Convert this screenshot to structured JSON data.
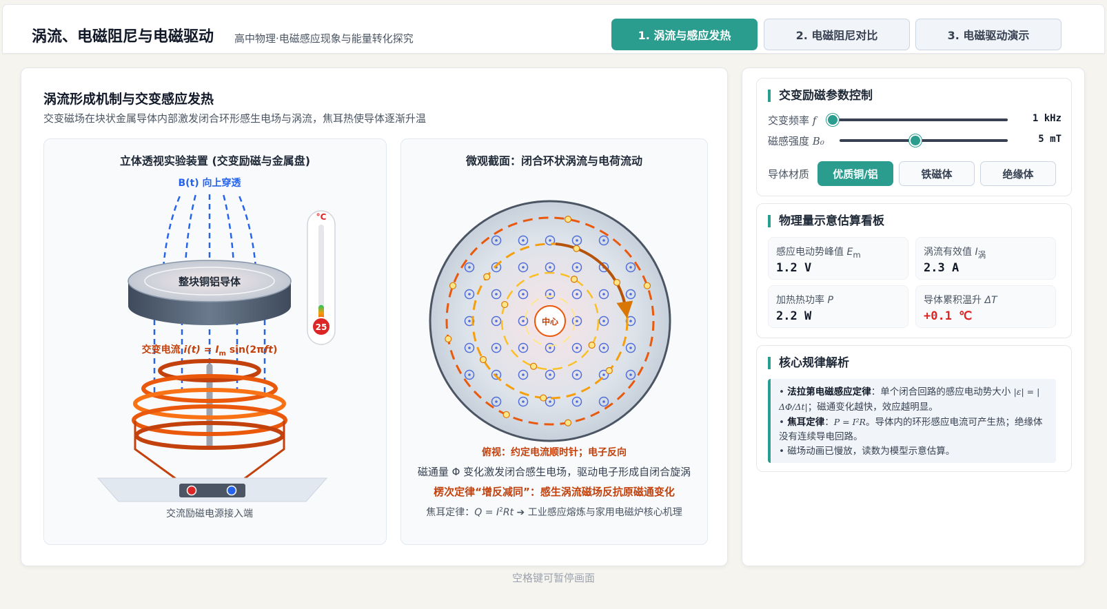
{
  "header": {
    "title": "涡流、电磁阻尼与电磁驱动",
    "subtitle": "高中物理·电磁感应现象与能量转化探究",
    "tabs": [
      {
        "label": "1. 涡流与感应发热",
        "active": true
      },
      {
        "label": "2. 电磁阻尼对比",
        "active": false
      },
      {
        "label": "3. 电磁驱动演示",
        "active": false
      }
    ]
  },
  "main": {
    "title": "涡流形成机制与交变感应发热",
    "description": "交变磁场在块状金属导体内部激发闭合环形感生电场与涡流，焦耳热使导体逐渐升温",
    "left_panel": {
      "title": "立体透视实验装置 (交变励磁与金属盘)",
      "field_label": "B(t) 向上穿透",
      "disk_label": "整块铜铝导体",
      "thermo_unit": "°C",
      "thermo_value": "25",
      "thermo_level": 0.2,
      "current_label_a": "交变电流 ",
      "current_label_i": "i(t)",
      "current_label_b": " = ",
      "current_label_c": "I",
      "current_label_sub": "m",
      "current_label_d": " sin(2π",
      "current_label_e": "ft",
      "current_label_f": ")",
      "source_label": "交流励磁电源接入端"
    },
    "right_panel": {
      "title": "微观截面：闭合环状涡流与电荷流动",
      "center_label": "中心",
      "view_caption": "俯视：约定电流顺时针；电子反向",
      "flux_caption": "磁通量 Φ 变化激发闭合感生电场，驱动电子形成自闭合旋涡",
      "lenz_caption": "楞次定律“增反减同”：感生涡流磁场反抗原磁通变化",
      "joule_a": "焦耳定律：",
      "joule_formula_a": "Q",
      "joule_formula_b": " = ",
      "joule_formula_c": "I",
      "joule_formula_sup": "2",
      "joule_formula_d": "Rt",
      "joule_b": " ➔ 工业感应熔炼与家用电磁炉核心机理"
    }
  },
  "controls": {
    "title": "交变励磁参数控制",
    "frequency": {
      "label": "交变频率",
      "symbol": "f",
      "value": "1 kHz",
      "level": 0.0
    },
    "field": {
      "label": "磁感强度",
      "symbol": "B₀",
      "value": "5 mT",
      "level": 0.45
    },
    "material": {
      "label": "导体材质",
      "options": [
        {
          "label": "优质铜/铝",
          "active": true
        },
        {
          "label": "铁磁体",
          "active": false
        },
        {
          "label": "绝缘体",
          "active": false
        }
      ]
    }
  },
  "dashboard": {
    "title": "物理量示意估算看板",
    "metrics": [
      {
        "label": "感应电动势峰值 ",
        "sym": "E",
        "sub": "m",
        "value": "1.2 V"
      },
      {
        "label": "涡流有效值 ",
        "sym": "I",
        "sub": "涡",
        "value": "2.3 A"
      },
      {
        "label": "加热热功率 ",
        "sym": "P",
        "sub": "",
        "value": "2.2 W"
      },
      {
        "label": "导体累积温升 ",
        "sym": "ΔT",
        "sub": "",
        "value": "+0.1 ℃"
      }
    ]
  },
  "laws": {
    "title": "核心规律解析",
    "faraday_title": "法拉第电磁感应定律",
    "faraday_text_a": "：单个闭合回路的感应电动势大小 ",
    "faraday_math_a": "|ε| = |ΔΦ/Δt|",
    "faraday_text_b": "；磁通变化越快，效应越明显。",
    "joule_title": "焦耳定律",
    "joule_text_a": "：",
    "joule_math": "P = I²R",
    "joule_text_b": "。导体内的环形感应电流可产生热；绝缘体没有连续导电回路。",
    "note": "磁场动画已慢放，读数为模型示意估算。"
  },
  "footer": {
    "hint": "空格键可暂停画面"
  },
  "colors": {
    "accent": "#2a9d8f",
    "field_line": "#2563eb",
    "eddy": "#ea580c",
    "warn": "#c2410c"
  }
}
